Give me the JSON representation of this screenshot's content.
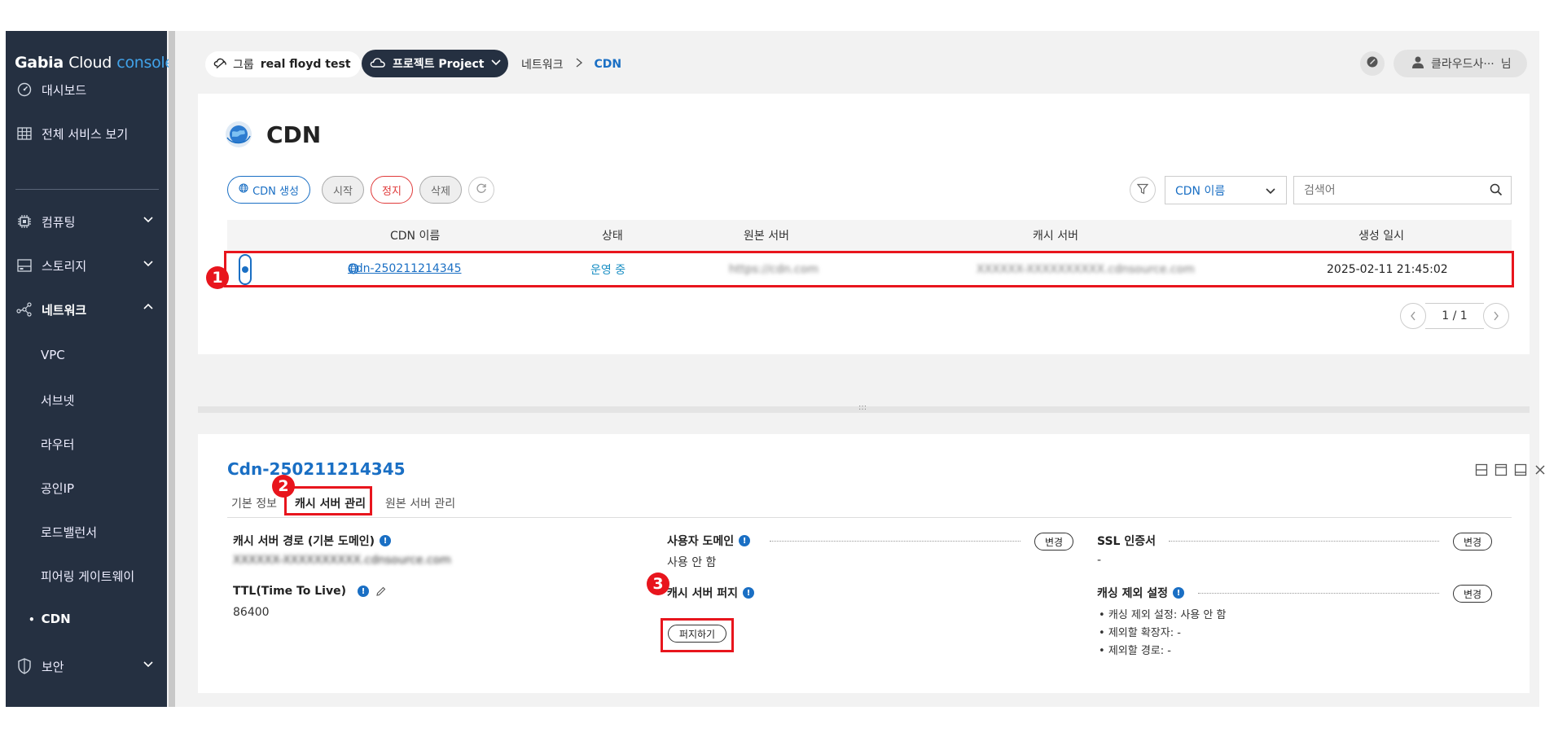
{
  "sidebar": {
    "logo": {
      "part1": "Gabia",
      "part2": "Cloud",
      "part3": "console"
    },
    "items": [
      {
        "label": "대시보드",
        "icon": "dashboard-icon"
      },
      {
        "label": "전체 서비스 보기",
        "icon": "grid-icon"
      },
      {
        "label": "컴퓨팅",
        "icon": "cpu-icon"
      },
      {
        "label": "스토리지",
        "icon": "storage-icon"
      },
      {
        "label": "네트워크",
        "icon": "network-icon"
      },
      {
        "label": "보안",
        "icon": "shield-icon"
      }
    ],
    "network_sub": [
      "VPC",
      "서브넷",
      "라우터",
      "공인IP",
      "로드밸런서",
      "피어링 게이트웨이",
      "CDN"
    ],
    "active_sub_bullet": "•"
  },
  "topbar": {
    "group_label": "그룹",
    "group_value": "real floyd test",
    "project_label": "프로젝트 Project",
    "breadcrumb": [
      "네트워크",
      "CDN"
    ],
    "user_name": "클라우드사···",
    "user_suffix": "님"
  },
  "page": {
    "title": "CDN",
    "buttons": {
      "create": "CDN 생성",
      "start": "시작",
      "stop": "정지",
      "delete": "삭제"
    },
    "filter_select": "CDN 이름",
    "search_placeholder": "검색어",
    "table": {
      "headers": [
        "CDN 이름",
        "상태",
        "원본 서버",
        "캐시 서버",
        "생성 일시"
      ],
      "rows": [
        {
          "name": "Cdn-250211214345",
          "status": "운영 중",
          "origin": "https://cdn.com",
          "cache": "XXXXXX-XXXXXXXXXX.cdnsource.com",
          "created": "2025-02-11 21:45:02"
        }
      ]
    },
    "pager": "1 / 1",
    "resizer_glyph": ":::"
  },
  "annotations": {
    "one": "1",
    "two": "2",
    "three": "3"
  },
  "detail": {
    "title": "Cdn-250211214345",
    "tabs": [
      "기본 정보",
      "캐시 서버 관리",
      "원본 서버 관리"
    ],
    "fields": {
      "cache_path_label": "캐시 서버 경로 (기본 도메인)",
      "cache_path_value": "XXXXXX-XXXXXXXXXX.cdnsource.com",
      "ttl_label": "TTL(Time To Live)",
      "ttl_value": "86400",
      "user_domain_label": "사용자 도메인",
      "user_domain_value": "사용 안 함",
      "purge_label": "캐시 서버 퍼지",
      "purge_button": "퍼지하기",
      "ssl_label": "SSL 인증서",
      "ssl_value": "-",
      "cache_excl_label": "캐싱 제외 설정",
      "change_button": "변경",
      "cache_excl_items": [
        "캐싱 제외 설정: 사용 안 함",
        "제외할 확장자: -",
        "제외할 경로: -"
      ],
      "info_glyph": "!"
    }
  },
  "colors": {
    "accent": "#1a6fc4",
    "sidebar": "#253041",
    "highlight": "#e8151d",
    "stop": "#e03a3a"
  }
}
